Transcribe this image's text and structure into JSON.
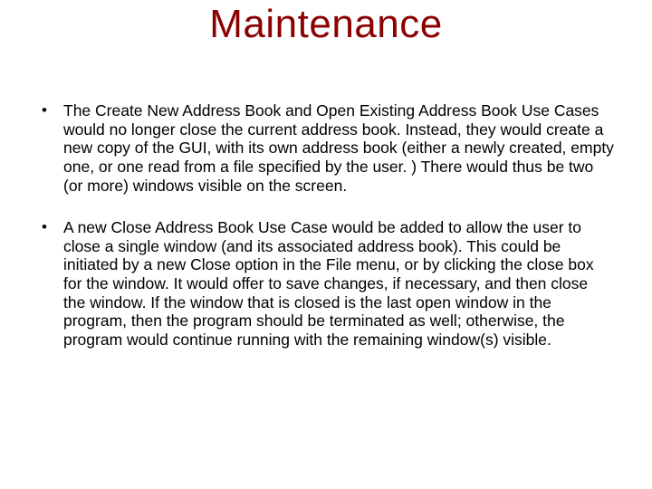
{
  "slide": {
    "title": "Maintenance",
    "bullets": [
      "The Create New Address Book and Open Existing Address Book Use Cases would no longer close the current address book. Instead, they would create a new copy of the GUI, with its own address book (either a newly created, empty one, or one read from a file specified by the user. ) There would thus be two (or more) windows visible on the screen.",
      "A new Close Address Book Use Case would be added to allow the user to close a single window (and its associated address book). This could be initiated by a new Close option in the File menu, or by clicking the close box for the window. It would offer to save changes, if necessary, and then close the window. If the window that is closed is the last open window in the program, then the program should be terminated as well; otherwise, the program would continue running with the remaining window(s) visible."
    ]
  }
}
